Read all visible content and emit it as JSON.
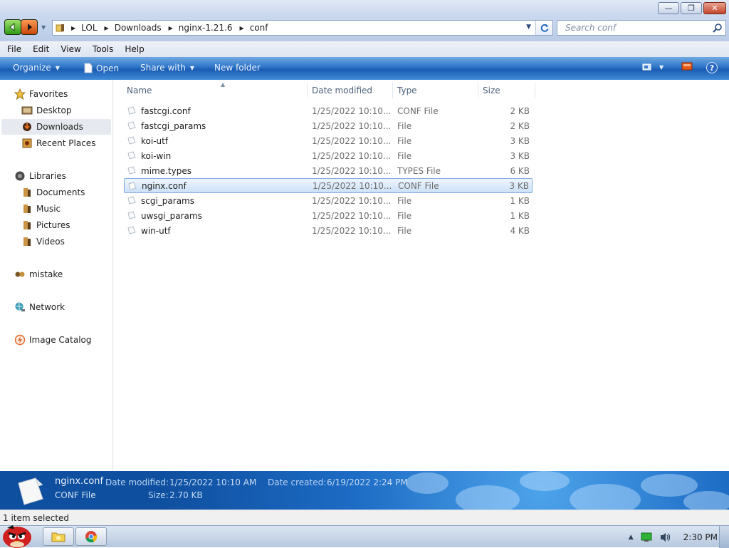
{
  "window": {
    "minimize_glyph": "—",
    "maximize_glyph": "❐",
    "close_glyph": "✕"
  },
  "address": {
    "crumbs": [
      "LOL",
      "Downloads",
      "nginx-1.21.6",
      "conf"
    ]
  },
  "search": {
    "placeholder": "Search conf"
  },
  "menu": {
    "items": [
      "File",
      "Edit",
      "View",
      "Tools",
      "Help"
    ]
  },
  "toolbar": {
    "organize": "Organize",
    "open": "Open",
    "share_with": "Share with",
    "new_folder": "New folder",
    "help_glyph": "?"
  },
  "nav": {
    "favorites": "Favorites",
    "desktop": "Desktop",
    "downloads": "Downloads",
    "recent_places": "Recent Places",
    "libraries": "Libraries",
    "documents": "Documents",
    "music": "Music",
    "pictures": "Pictures",
    "videos": "Videos",
    "mistake": "mistake",
    "network": "Network",
    "image_catalog": "Image Catalog"
  },
  "columns": {
    "name": "Name",
    "date": "Date modified",
    "type": "Type",
    "size": "Size"
  },
  "files": [
    {
      "name": "fastcgi.conf",
      "date": "1/25/2022 10:10...",
      "type": "CONF File",
      "size": "2 KB"
    },
    {
      "name": "fastcgi_params",
      "date": "1/25/2022 10:10...",
      "type": "File",
      "size": "2 KB"
    },
    {
      "name": "koi-utf",
      "date": "1/25/2022 10:10...",
      "type": "File",
      "size": "3 KB"
    },
    {
      "name": "koi-win",
      "date": "1/25/2022 10:10...",
      "type": "File",
      "size": "3 KB"
    },
    {
      "name": "mime.types",
      "date": "1/25/2022 10:10...",
      "type": "TYPES File",
      "size": "6 KB"
    },
    {
      "name": "nginx.conf",
      "date": "1/25/2022 10:10...",
      "type": "CONF File",
      "size": "3 KB",
      "selected": true
    },
    {
      "name": "scgi_params",
      "date": "1/25/2022 10:10...",
      "type": "File",
      "size": "1 KB"
    },
    {
      "name": "uwsgi_params",
      "date": "1/25/2022 10:10...",
      "type": "File",
      "size": "1 KB"
    },
    {
      "name": "win-utf",
      "date": "1/25/2022 10:10...",
      "type": "File",
      "size": "4 KB"
    }
  ],
  "details": {
    "name": "nginx.conf",
    "type": "CONF File",
    "date_modified_label": "Date modified:",
    "date_modified": "1/25/2022 10:10 AM",
    "date_created_label": "Date created:",
    "date_created": "6/19/2022 2:24 PM",
    "size_label": "Size:",
    "size": "2.70 KB"
  },
  "status": {
    "text": "1 item selected"
  },
  "taskbar": {
    "clock": "2:30 PM"
  },
  "colors": {
    "selection_bg": "#cce1f7",
    "selection_border": "#84acdd",
    "toolbar_blue": "#2c73c5",
    "details_blue": "#1c6bc4"
  }
}
